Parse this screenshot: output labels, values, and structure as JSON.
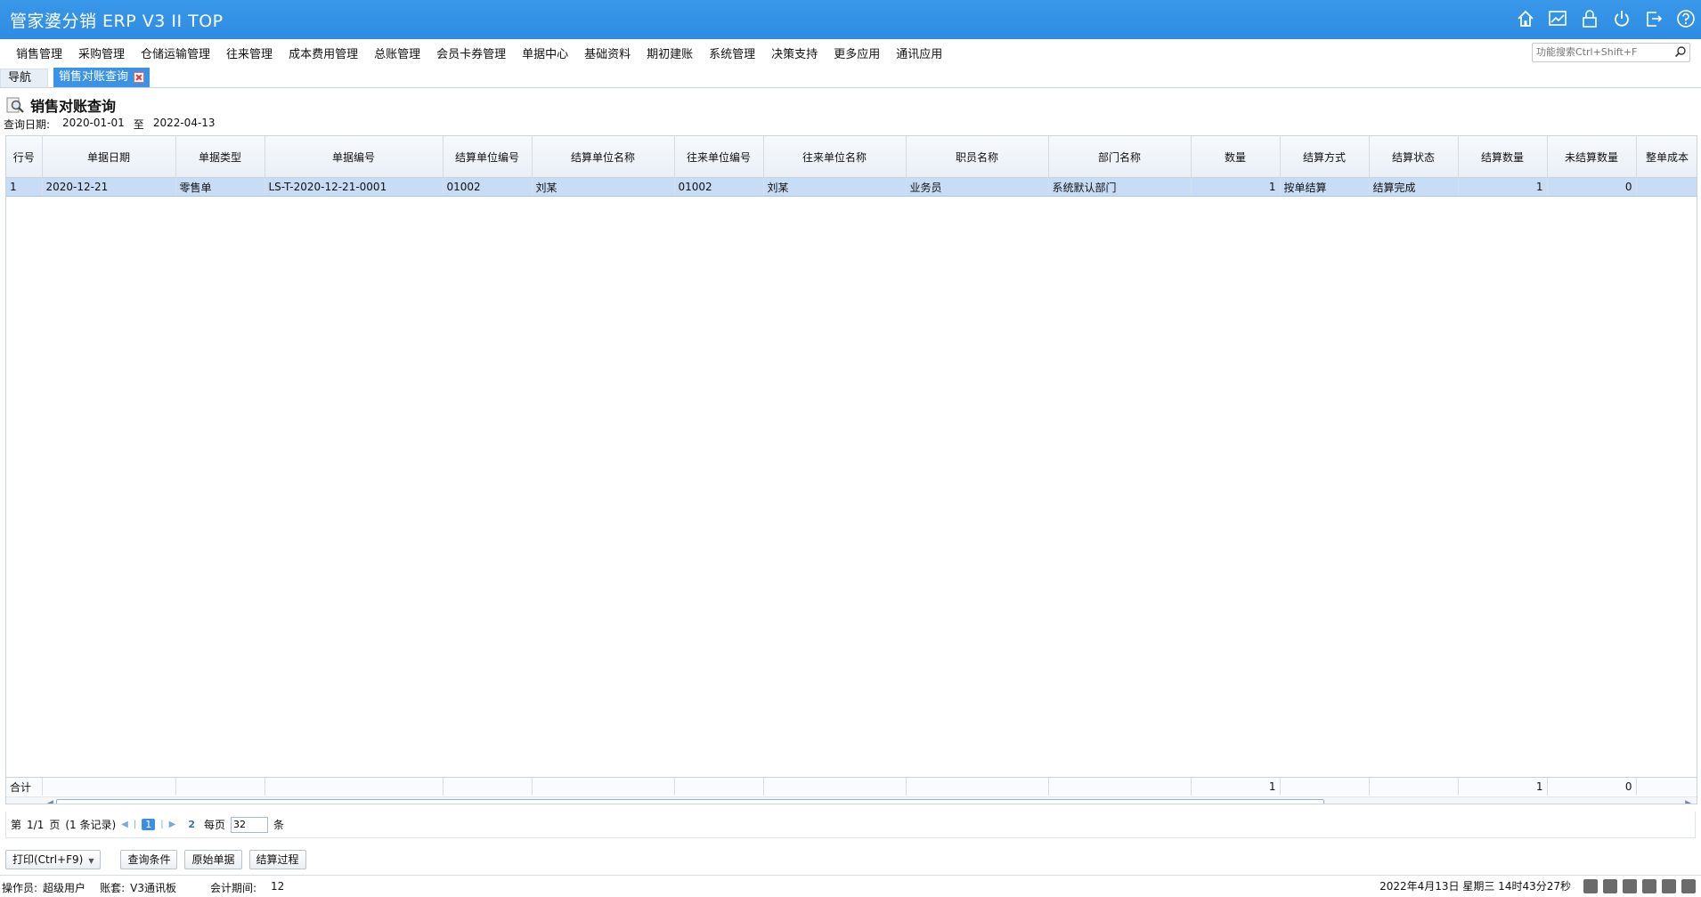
{
  "app": {
    "title": "管家婆分销 ERP V3 II TOP"
  },
  "title_icons": [
    "home-icon",
    "chart-icon",
    "lock-icon",
    "power-icon",
    "exit-icon",
    "help-icon"
  ],
  "menu": [
    "销售管理",
    "采购管理",
    "仓储运输管理",
    "往来管理",
    "成本费用管理",
    "总账管理",
    "会员卡券管理",
    "单据中心",
    "基础资料",
    "期初建账",
    "系统管理",
    "决策支持",
    "更多应用",
    "通讯应用"
  ],
  "search": {
    "placeholder": "功能搜索Ctrl+Shift+F"
  },
  "tabs": {
    "nav": "导航",
    "active": "销售对账查询"
  },
  "page": {
    "title": "销售对账查询",
    "query_label": "查询日期:",
    "date_from": "2020-01-01",
    "date_sep": "至",
    "date_to": "2022-04-13"
  },
  "table": {
    "headers": [
      "行号",
      "单据日期",
      "单据类型",
      "单据编号",
      "结算单位编号",
      "结算单位名称",
      "往来单位编号",
      "往来单位名称",
      "职员名称",
      "部门名称",
      "数量",
      "结算方式",
      "结算状态",
      "结算数量",
      "未结算数量",
      "整单成本"
    ],
    "rows": [
      [
        "1",
        "2020-12-21",
        "零售单",
        "LS-T-2020-12-21-0001",
        "01002",
        "刘某",
        "01002",
        "刘某",
        "业务员",
        "系统默认部门",
        "1",
        "按单结算",
        "结算完成",
        "1",
        "0",
        ""
      ]
    ],
    "totals": {
      "label": "合计",
      "qty": "1",
      "settled_qty": "1",
      "unsettled_qty": "0"
    }
  },
  "pager": {
    "prefix": "第",
    "page_info": "1/1",
    "suffix": "页",
    "records": "(1 条记录)",
    "current": "1",
    "refresh": "2",
    "per_page_label": "每页",
    "per_page": "32",
    "unit": "条"
  },
  "actions": {
    "print": "打印(Ctrl+F9)",
    "query": "查询条件",
    "original": "原始单据",
    "process": "结算过程"
  },
  "status": {
    "operator_label": "操作员:",
    "operator": "超级用户",
    "account_label": "账套:",
    "account": "V3通讯板",
    "period_label": "会计期间:",
    "period": "12",
    "datetime": "2022年4月13日  星期三  14时43分27秒"
  }
}
